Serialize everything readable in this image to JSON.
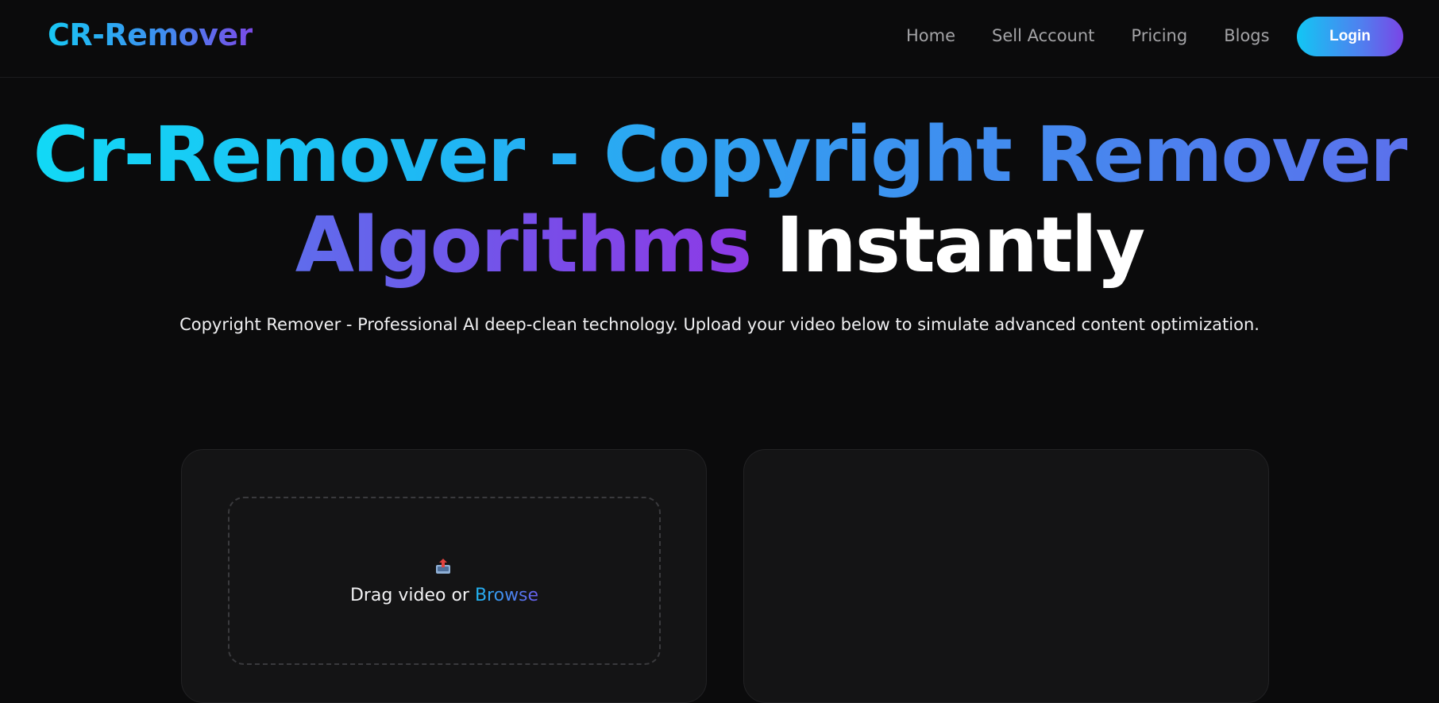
{
  "brand": {
    "logo_text": "CR-Remover"
  },
  "nav": {
    "links": [
      {
        "label": "Home"
      },
      {
        "label": "Sell Account"
      },
      {
        "label": "Pricing"
      },
      {
        "label": "Blogs"
      }
    ],
    "login_label": "Login"
  },
  "hero": {
    "title_line1": "Cr-Remover - Copyright Remover",
    "title_line2_gradient": "Algorithms",
    "title_line2_plain": "Instantly",
    "subtitle": "Copyright Remover - Professional AI deep-clean technology. Upload your video below to simulate advanced content optimization."
  },
  "upload": {
    "drag_text": "Drag video or",
    "browse_label": "Browse"
  },
  "colors": {
    "background": "#0b0b0c",
    "card": "#141415",
    "accent_cyan": "#11dcf6",
    "accent_blue": "#3a95f0",
    "accent_purple": "#8e3ae6"
  }
}
